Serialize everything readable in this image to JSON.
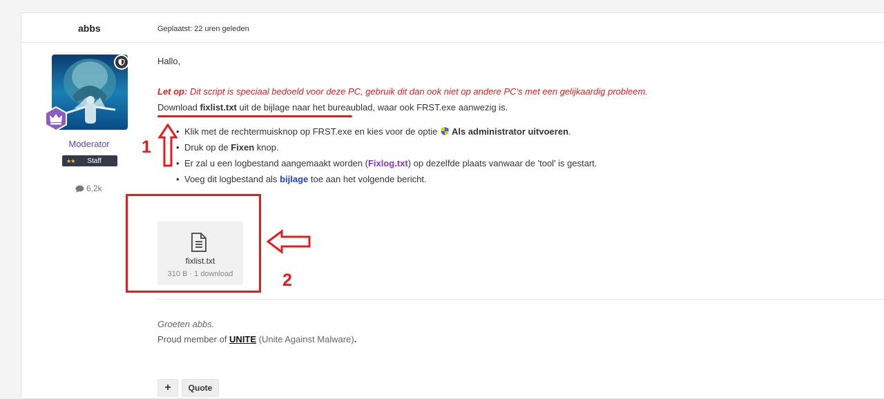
{
  "post": {
    "author": "abbs",
    "posted": "Geplaatst: 22 uren geleden"
  },
  "profile": {
    "role": "Moderator",
    "badge": {
      "stars": "★★",
      "label": "Staff"
    },
    "post_count": "6,2k",
    "icons": {
      "shield": "shield-icon",
      "crown": "crown-icon",
      "comment": "comment-icon"
    }
  },
  "body": {
    "greeting": "Hallo,",
    "warning_lead": "Let op:",
    "warning_text": " Dit script is speciaal bedoeld voor deze PC, gebruik dit dan ook niet op andere PC's met een gelijkaardig probleem.",
    "download_pre": "Download ",
    "download_file": "fixlist.txt",
    "download_post": " uit de bijlage naar het bureaublad, waar ook FRST.exe aanwezig is.",
    "steps": {
      "s1_pre": "Klik met de rechtermuisknop op FRST.exe en kies voor de optie ",
      "s1_bold": "Als administrator uitvoeren",
      "s1_post": ".",
      "s2_pre": "Druk op de ",
      "s2_bold": "Fixen",
      "s2_post": " knop.",
      "s3_pre": "Er zal u een logbestand aangemaakt worden (",
      "s3_link": "Fixlog.txt",
      "s3_post": ") op dezelfde plaats vanwaar de 'tool' is gestart.",
      "s4_pre": "Voeg dit logbestand als ",
      "s4_link": "bijlage",
      "s4_post": " toe aan het volgende bericht."
    },
    "annotations": {
      "label_1": "1",
      "label_2": "2"
    },
    "attachment": {
      "name": "fixlist.txt",
      "meta": "310 B · 1 download"
    }
  },
  "signature": {
    "line1": "Groeten abbs.",
    "line2_pre": "Proud member of ",
    "line2_link": "UNITE",
    "line2_paren": " (Unite Against Malware)",
    "line2_end": "."
  },
  "actions": {
    "plus": "+",
    "quote": "Quote"
  },
  "colors": {
    "annotation_red": "#e11d1d",
    "role_purple": "#6a3fa8",
    "link_purple": "#8a35c8",
    "link_blue": "#1f3fd0"
  }
}
